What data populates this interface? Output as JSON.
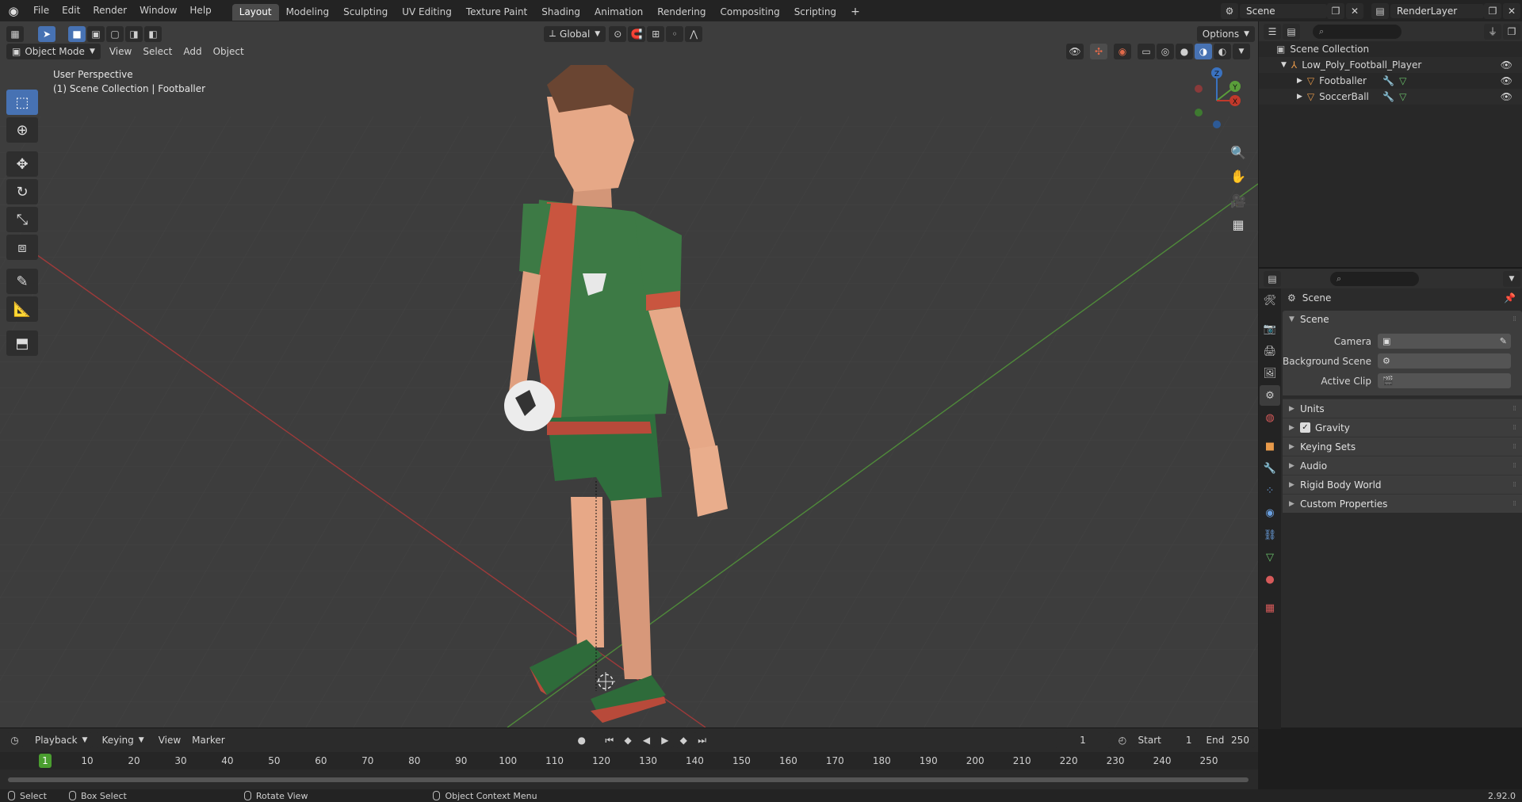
{
  "topbar": {
    "menus": [
      "File",
      "Edit",
      "Render",
      "Window",
      "Help"
    ],
    "workspaces": [
      "Layout",
      "Modeling",
      "Sculpting",
      "UV Editing",
      "Texture Paint",
      "Shading",
      "Animation",
      "Rendering",
      "Compositing",
      "Scripting"
    ],
    "active_workspace": "Layout",
    "scene_name": "Scene",
    "view_layer": "RenderLayer"
  },
  "viewport": {
    "mode": "Object Mode",
    "menus": [
      "View",
      "Select",
      "Add",
      "Object"
    ],
    "transform_orientation": "Global",
    "options_label": "Options",
    "info_line1": "User Perspective",
    "info_line2": "(1) Scene Collection | Footballer",
    "gizmo": {
      "x": "X",
      "y": "Y",
      "z": "Z"
    }
  },
  "toolbar": {
    "tools": [
      "select-box-icon",
      "cursor-icon",
      "move-icon",
      "rotate-icon",
      "scale-icon",
      "transform-icon",
      "annotate-icon",
      "measure-icon",
      "add-cube-icon"
    ]
  },
  "outliner": {
    "root": "Scene Collection",
    "collection": "Low_Poly_Football_Player",
    "objects": [
      "Footballer",
      "SoccerBall"
    ]
  },
  "properties": {
    "context": "Scene",
    "panel_title": "Scene",
    "fields": [
      {
        "label": "Camera",
        "value": ""
      },
      {
        "label": "Background Scene",
        "value": ""
      },
      {
        "label": "Active Clip",
        "value": ""
      }
    ],
    "subpanels": [
      {
        "label": "Units",
        "checkbox": false
      },
      {
        "label": "Gravity",
        "checkbox": true
      },
      {
        "label": "Keying Sets",
        "checkbox": false
      },
      {
        "label": "Audio",
        "checkbox": false
      },
      {
        "label": "Rigid Body World",
        "checkbox": false
      },
      {
        "label": "Custom Properties",
        "checkbox": false
      }
    ]
  },
  "timeline": {
    "menus": [
      "Playback",
      "Keying",
      "View",
      "Marker"
    ],
    "current_frame": "1",
    "start_label": "Start",
    "start": "1",
    "end_label": "End",
    "end": "250",
    "ticks": [
      "1",
      "10",
      "20",
      "30",
      "40",
      "50",
      "60",
      "70",
      "80",
      "90",
      "100",
      "110",
      "120",
      "130",
      "140",
      "150",
      "160",
      "170",
      "180",
      "190",
      "200",
      "210",
      "220",
      "230",
      "240",
      "250"
    ]
  },
  "statusbar": {
    "items": [
      "Select",
      "Box Select",
      "Rotate View",
      "Object Context Menu"
    ],
    "version": "2.92.0"
  },
  "colors": {
    "accent": "#4772b3",
    "x_axis": "#c0392b",
    "y_axis": "#5a9e3a",
    "z_axis": "#3a72c0",
    "current_frame": "#4a9e2f"
  }
}
